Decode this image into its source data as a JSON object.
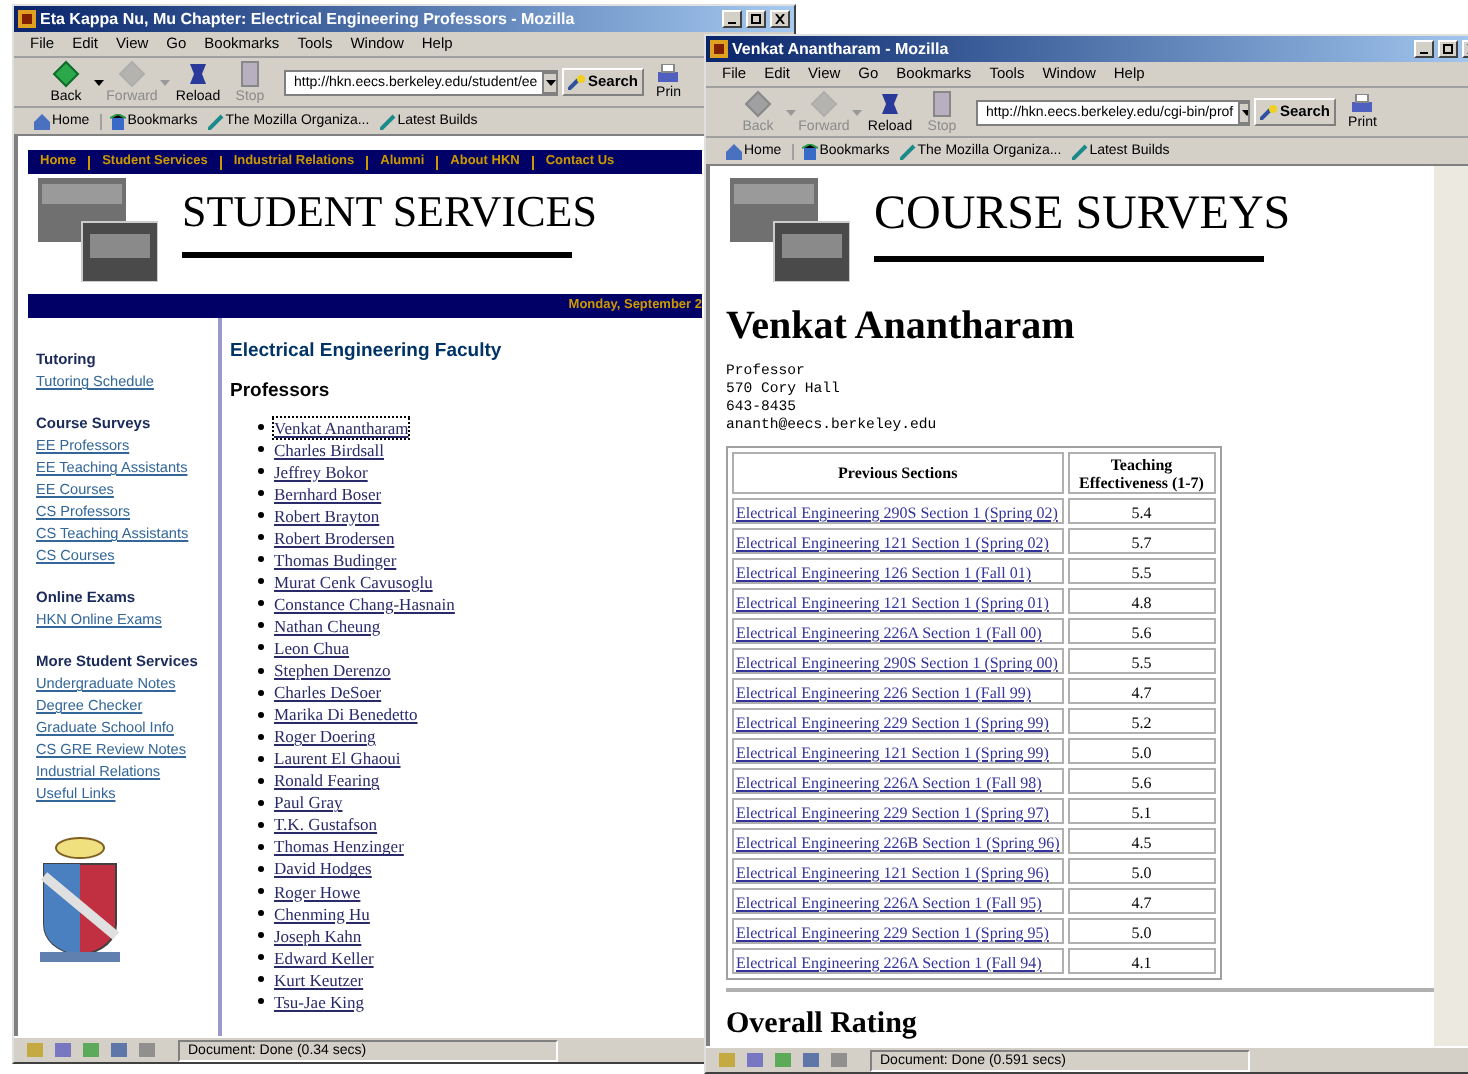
{
  "left_window": {
    "title": "Eta Kappa Nu, Mu Chapter: Electrical Engineering Professors - Mozilla",
    "menu": [
      "File",
      "Edit",
      "View",
      "Go",
      "Bookmarks",
      "Tools",
      "Window",
      "Help"
    ],
    "nav_buttons": [
      {
        "label": "Back",
        "disabled": false
      },
      {
        "label": "Forward",
        "disabled": true
      },
      {
        "label": "Reload",
        "disabled": false
      },
      {
        "label": "Stop",
        "disabled": true
      }
    ],
    "address": "http://hkn.eecs.berkeley.edu/student/ee",
    "search_button": "Search",
    "print_button": "Prin",
    "personal_bar": [
      "Home",
      "Bookmarks",
      "The Mozilla Organiza...",
      "Latest Builds"
    ],
    "page": {
      "site_nav": [
        "Home",
        "Student Services",
        "Industrial Relations",
        "Alumni",
        "About HKN",
        "Contact Us"
      ],
      "banner_title": "STUDENT SERVICES",
      "date": "Monday, September 2",
      "sidebar": [
        {
          "heading": "Tutoring",
          "links": [
            "Tutoring Schedule"
          ]
        },
        {
          "heading": "Course Surveys",
          "links": [
            "EE Professors",
            "EE Teaching Assistants",
            "EE Courses",
            "CS Professors",
            "CS Teaching Assistants",
            "CS Courses"
          ]
        },
        {
          "heading": "Online Exams",
          "links": [
            "HKN Online Exams"
          ]
        },
        {
          "heading": "More Student Services",
          "links": [
            "Undergraduate Notes",
            "Degree Checker",
            "Graduate School Info",
            "CS GRE Review Notes",
            "Industrial Relations",
            "Useful Links"
          ]
        }
      ],
      "heading": "Electrical Engineering Faculty",
      "subheading": "Professors",
      "professors": [
        {
          "name": "Venkat Anantharam",
          "focused": true
        },
        {
          "name": "Charles Birdsall",
          "focused": false
        },
        {
          "name": "Jeffrey Bokor",
          "focused": false
        },
        {
          "name": "Bernhard Boser",
          "focused": false
        },
        {
          "name": "Robert Brayton",
          "focused": false
        },
        {
          "name": "Robert Brodersen",
          "focused": false
        },
        {
          "name": "Thomas Budinger",
          "focused": false
        },
        {
          "name": "Murat Cenk Cavusoglu",
          "focused": false
        },
        {
          "name": "Constance Chang-Hasnain",
          "focused": false
        },
        {
          "name": "Nathan Cheung",
          "focused": false
        },
        {
          "name": "Leon Chua",
          "focused": false
        },
        {
          "name": "Stephen Derenzo",
          "focused": false
        },
        {
          "name": "Charles DeSoer",
          "focused": false
        },
        {
          "name": "Marika Di Benedetto",
          "focused": false
        },
        {
          "name": "Roger Doering",
          "focused": false
        },
        {
          "name": "Laurent El Ghaoui",
          "focused": false
        },
        {
          "name": "Ronald Fearing",
          "focused": false
        },
        {
          "name": "Paul Gray",
          "focused": false
        },
        {
          "name": "T.K. Gustafson",
          "focused": false
        },
        {
          "name": "Thomas Henzinger",
          "focused": false
        },
        {
          "name": "David Hodges",
          "focused": false
        },
        {
          "name": "Roger Howe",
          "focused": false
        },
        {
          "name": "Chenming Hu",
          "focused": false
        },
        {
          "name": "Joseph Kahn",
          "focused": false
        },
        {
          "name": "Edward Keller",
          "focused": false
        },
        {
          "name": "Kurt Keutzer",
          "focused": false
        },
        {
          "name": "Tsu-Jae King",
          "focused": false
        }
      ]
    },
    "status": "Document: Done (0.34 secs)"
  },
  "right_window": {
    "title": "Venkat Anantharam - Mozilla",
    "menu": [
      "File",
      "Edit",
      "View",
      "Go",
      "Bookmarks",
      "Tools",
      "Window",
      "Help"
    ],
    "nav_buttons": [
      {
        "label": "Back",
        "disabled": true
      },
      {
        "label": "Forward",
        "disabled": true
      },
      {
        "label": "Reload",
        "disabled": false
      },
      {
        "label": "Stop",
        "disabled": true
      }
    ],
    "address": "http://hkn.eecs.berkeley.edu/cgi-bin/prof",
    "search_button": "Search",
    "print_button": "Print",
    "personal_bar": [
      "Home",
      "Bookmarks",
      "The Mozilla Organiza...",
      "Latest Builds"
    ],
    "page": {
      "banner_title": "COURSE SURVEYS",
      "name": "Venkat Anantharam",
      "contact_lines": [
        "Professor",
        "570 Cory Hall",
        "643-8435",
        "ananth@eecs.berkeley.edu"
      ],
      "table": {
        "columns": [
          "Previous Sections",
          "Teaching Effectiveness (1-7)"
        ],
        "rows": [
          [
            "Electrical Engineering 290S Section 1 (Spring 02)",
            "5.4"
          ],
          [
            "Electrical Engineering 121 Section 1 (Spring 02)",
            "5.7"
          ],
          [
            "Electrical Engineering 126 Section 1 (Fall 01)",
            "5.5"
          ],
          [
            "Electrical Engineering 121 Section 1 (Spring 01)",
            "4.8"
          ],
          [
            "Electrical Engineering 226A Section 1 (Fall 00)",
            "5.6"
          ],
          [
            "Electrical Engineering 290S Section 1 (Spring 00)",
            "5.5"
          ],
          [
            "Electrical Engineering 226 Section 1 (Fall 99)",
            "4.7"
          ],
          [
            "Electrical Engineering 229 Section 1 (Spring 99)",
            "5.2"
          ],
          [
            "Electrical Engineering 121 Section 1 (Spring 99)",
            "5.0"
          ],
          [
            "Electrical Engineering 226A Section 1 (Fall 98)",
            "5.6"
          ],
          [
            "Electrical Engineering 229 Section 1 (Spring 97)",
            "5.1"
          ],
          [
            "Electrical Engineering 226B Section 1 (Spring 96)",
            "4.5"
          ],
          [
            "Electrical Engineering 121 Section 1 (Spring 96)",
            "5.0"
          ],
          [
            "Electrical Engineering 226A Section 1 (Fall 95)",
            "4.7"
          ],
          [
            "Electrical Engineering 229 Section 1 (Spring 95)",
            "5.0"
          ],
          [
            "Electrical Engineering 226A Section 1 (Fall 94)",
            "4.1"
          ]
        ]
      },
      "section_heading": "Overall Rating"
    },
    "status": "Document: Done (0.591 secs)"
  }
}
